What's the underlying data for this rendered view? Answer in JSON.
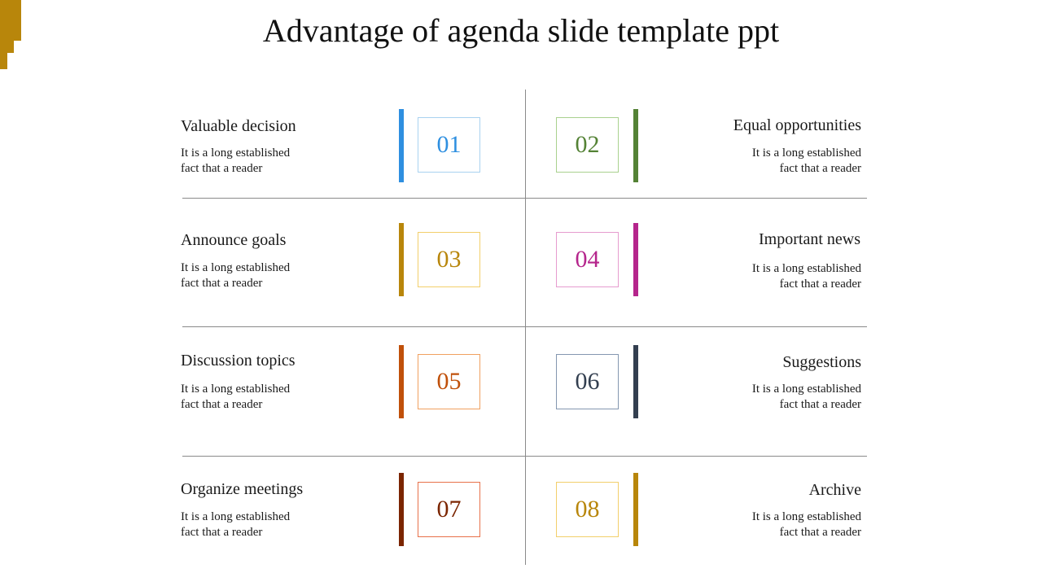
{
  "title": "Advantage of agenda slide template ppt",
  "accent_color": "#b8860b",
  "items": [
    {
      "number": "01",
      "heading": "Valuable decision",
      "line1": "It is a long established",
      "line2": "fact that a reader",
      "bar_color": "#2e8fe0",
      "box_border": "#a9d2f0",
      "num_color": "#2e8fe0"
    },
    {
      "number": "02",
      "heading": "Equal opportunities",
      "line1": "It is a long established",
      "line2": "fact that a reader",
      "bar_color": "#548235",
      "box_border": "#a9d18e",
      "num_color": "#548235"
    },
    {
      "number": "03",
      "heading": "Announce goals",
      "line1": "It is a long established",
      "line2": "fact that a reader",
      "bar_color": "#b8860b",
      "box_border": "#f2cf6b",
      "num_color": "#b8860b"
    },
    {
      "number": "04",
      "heading": "Important news",
      "line1": "It is a long established",
      "line2": "fact that a reader",
      "bar_color": "#b5258c",
      "box_border": "#e69ccf",
      "num_color": "#b5258c"
    },
    {
      "number": "05",
      "heading": "Discussion topics",
      "line1": "It is a long established",
      "line2": "fact that a reader",
      "bar_color": "#c0500a",
      "box_border": "#f0a060",
      "num_color": "#c0500a"
    },
    {
      "number": "06",
      "heading": "Suggestions",
      "line1": "It is a long established",
      "line2": "fact that a reader",
      "bar_color": "#333f50",
      "box_border": "#8497b0",
      "num_color": "#333f50"
    },
    {
      "number": "07",
      "heading": "Organize meetings",
      "line1": "It is a long established",
      "line2": "fact that a reader",
      "bar_color": "#7b2500",
      "box_border": "#e8714a",
      "num_color": "#7b2500"
    },
    {
      "number": "08",
      "heading": "Archive",
      "line1": "It is a long established",
      "line2": "fact that a reader",
      "bar_color": "#b8860b",
      "box_border": "#f2cf6b",
      "num_color": "#b8860b"
    }
  ]
}
